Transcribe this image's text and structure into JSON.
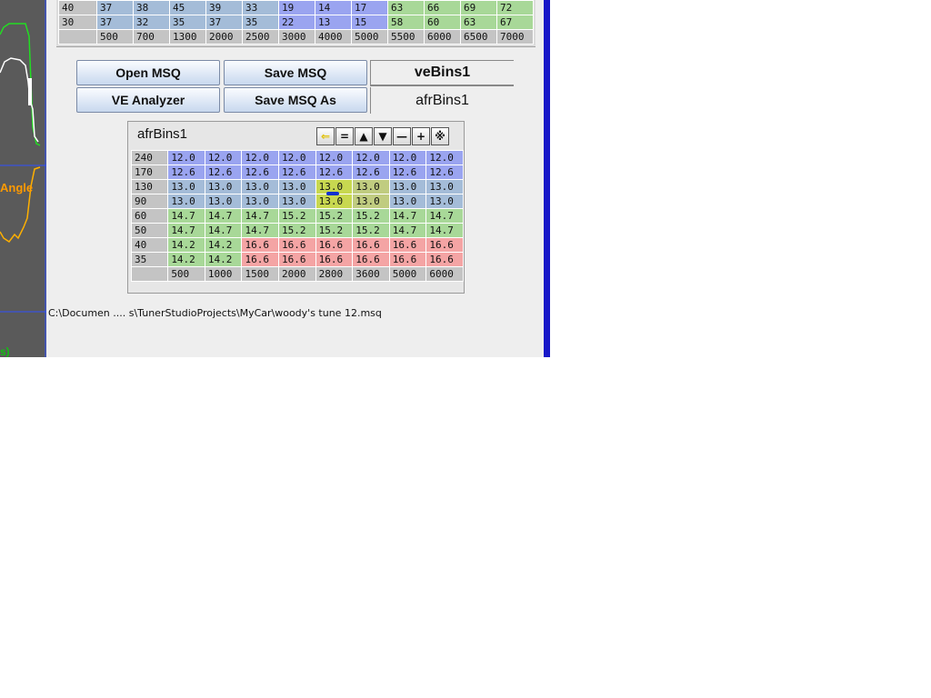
{
  "gauges": {
    "angle_label": "Angle",
    "bottom_label": "s)"
  },
  "ve_table": {
    "rows": [
      {
        "label": "40",
        "cells": [
          "37",
          "38",
          "45",
          "39",
          "33",
          "19",
          "14",
          "17",
          "63",
          "66",
          "69",
          "72"
        ]
      },
      {
        "label": "30",
        "cells": [
          "37",
          "32",
          "35",
          "37",
          "35",
          "22",
          "13",
          "15",
          "58",
          "60",
          "63",
          "67"
        ]
      }
    ],
    "columns": [
      "500",
      "700",
      "1300",
      "2000",
      "2500",
      "3000",
      "4000",
      "5000",
      "5500",
      "6000",
      "6500",
      "7000"
    ]
  },
  "buttons": {
    "open_msq": "Open MSQ",
    "save_msq": "Save MSQ",
    "ve_analyzer": "VE Analyzer",
    "save_msq_as": "Save MSQ As"
  },
  "tabs": [
    {
      "label": "veBins1"
    },
    {
      "label": "afrBins1"
    }
  ],
  "afr_table": {
    "title": "afrBins1",
    "toolbar_icons": [
      "arrow-left-icon",
      "equals-icon",
      "arrow-up-icon",
      "arrow-down-icon",
      "minus-icon",
      "plus-icon",
      "multiply-icon"
    ],
    "rows": [
      {
        "label": "240",
        "cells": [
          "12.0",
          "12.0",
          "12.0",
          "12.0",
          "12.0",
          "12.0",
          "12.0",
          "12.0"
        ]
      },
      {
        "label": "170",
        "cells": [
          "12.6",
          "12.6",
          "12.6",
          "12.6",
          "12.6",
          "12.6",
          "12.6",
          "12.6"
        ]
      },
      {
        "label": "130",
        "cells": [
          "13.0",
          "13.0",
          "13.0",
          "13.0",
          "13.0",
          "13.0",
          "13.0",
          "13.0"
        ]
      },
      {
        "label": "90",
        "cells": [
          "13.0",
          "13.0",
          "13.0",
          "13.0",
          "13.0",
          "13.0",
          "13.0",
          "13.0"
        ]
      },
      {
        "label": "60",
        "cells": [
          "14.7",
          "14.7",
          "14.7",
          "15.2",
          "15.2",
          "15.2",
          "14.7",
          "14.7"
        ]
      },
      {
        "label": "50",
        "cells": [
          "14.7",
          "14.7",
          "14.7",
          "15.2",
          "15.2",
          "15.2",
          "14.7",
          "14.7"
        ]
      },
      {
        "label": "40",
        "cells": [
          "14.2",
          "14.2",
          "16.6",
          "16.6",
          "16.6",
          "16.6",
          "16.6",
          "16.6"
        ]
      },
      {
        "label": "35",
        "cells": [
          "14.2",
          "14.2",
          "16.6",
          "16.6",
          "16.6",
          "16.6",
          "16.6",
          "16.6"
        ]
      }
    ],
    "columns": [
      "500",
      "1000",
      "1500",
      "2000",
      "2800",
      "3600",
      "5000",
      "6000"
    ]
  },
  "status": {
    "file_path": "C:\\Documen .... s\\TunerStudioProjects\\MyCar\\woody's tune 12.msq"
  },
  "colors": {
    "blue_cell": "#9aa4f0",
    "steel_cell": "#a4bcd8",
    "green_cell": "#a8d898",
    "red_cell": "#f4a4a4",
    "highlight_cell": "#c8d850",
    "highlight_alt": "#c0cc80",
    "accent_border": "#1818c8"
  }
}
